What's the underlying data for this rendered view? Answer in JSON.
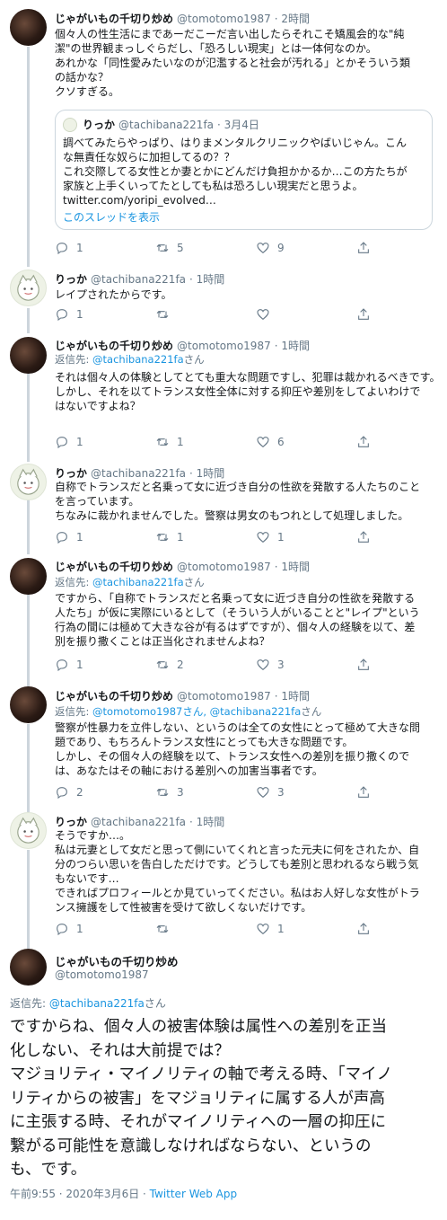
{
  "icons": {
    "reply": "reply-icon",
    "retweet": "retweet-icon",
    "like": "heart-icon",
    "share": "share-icon"
  },
  "colors": {
    "link": "#1b95e0",
    "meta": "#657786",
    "text": "#14171a",
    "thread": "#cdd5dc"
  },
  "tweets": [
    {
      "name": "じゃがいもの千切り炒め",
      "handle": "@tomotomo1987",
      "time": "· 2時間",
      "lines": [
        "個々人の性生活にまであーだこーだ言い出したらそれこそ矯風会的な\"純",
        "潔\"の世界観まっしぐらだし、「恐ろしい現実」とは一体何なのか。",
        "あれかな「同性愛みたいなのが氾濫すると社会が汚れる」とかそういう類",
        "の話かな？",
        "クソすぎる。"
      ],
      "quote": {
        "name": "りっか",
        "handle": "@tachibana221fa",
        "time": "· 3月4日",
        "lines": [
          "調べてみたらやっぱり、はりまメンタルクリニックやばいじゃん。こん",
          "な無責任な奴らに加担してるの？？",
          "これ交際してる女性とか妻とかにどんだけ負担かかるか…この方たちが",
          "家族と上手くいってたとしても私は恐ろしい現実だと思うよ。",
          "twitter.com/yoripi_evolved…"
        ],
        "show_thread": "このスレッドを表示"
      },
      "reply_count": "1",
      "retweet_count": "5",
      "like_count": "9"
    },
    {
      "name": "りっか",
      "handle": "@tachibana221fa",
      "time": "· 1時間",
      "lines": [
        "レイプされたからです。"
      ],
      "reply_count": "1",
      "retweet_count": "",
      "like_count": ""
    },
    {
      "name": "じゃがいもの千切り炒め",
      "handle": "@tomotomo1987",
      "time": "· 1時間",
      "reply_prefix": "返信先: ",
      "reply_target": "@tachibana221fa",
      "reply_suffix": "さん",
      "lines": [
        "それは個々人の体験としてとても重大な問題ですし、犯罪は裁かれるべきです。",
        "しかし、それを以てトランス女性全体に対する抑圧や差別をしてよいわけで",
        "はないですよね？"
      ],
      "reply_count": "1",
      "retweet_count": "1",
      "like_count": "6"
    },
    {
      "name": "りっか",
      "handle": "@tachibana221fa",
      "time": "· 1時間",
      "lines": [
        "自称でトランスだと名乗って女に近づき自分の性欲を発散する人たちのこと",
        "を言っています。",
        "ちなみに裁かれませんでした。警察は男女のもつれとして処理しました。"
      ],
      "reply_count": "1",
      "retweet_count": "1",
      "like_count": "1"
    },
    {
      "name": "じゃがいもの千切り炒め",
      "handle": "@tomotomo1987",
      "time": "· 1時間",
      "reply_prefix": "返信先: ",
      "reply_target": "@tachibana221fa",
      "reply_suffix": "さん",
      "lines": [
        "ですから、「自称でトランスだと名乗って女に近づき自分の性欲を発散する",
        "人たち」が仮に実際にいるとして（そういう人がいることと\"レイプ\"という",
        "行為の間には極めて大きな谷が有るはずですが）、個々人の経験を以て、差",
        "別を振り撒くことは正当化されませんよね？"
      ],
      "reply_count": "1",
      "retweet_count": "2",
      "like_count": "3"
    },
    {
      "name": "じゃがいもの千切り炒め",
      "handle": "@tomotomo1987",
      "time": "· 1時間",
      "reply_prefix": "返信先: ",
      "reply_target": "@tomotomo1987さん, @tachibana221fa",
      "reply_suffix": "さん",
      "lines": [
        "警察が性暴力を立件しない、というのは全ての女性にとって極めて大きな問",
        "題であり、もちろんトランス女性にとっても大きな問題です。",
        "しかし、その個々人の経験を以て、トランス女性への差別を振り撒くので",
        "は、あなたはその軸における差別への加害当事者です。"
      ],
      "reply_count": "2",
      "retweet_count": "3",
      "like_count": "3"
    },
    {
      "name": "りっか",
      "handle": "@tachibana221fa",
      "time": "· 1時間",
      "lines": [
        "そうですか…。",
        "私は元妻として女だと思って側にいてくれと言った元夫に何をされたか、自",
        "分のつらい思いを告白しただけです。どうしても差別と思われるなら戦う気",
        "もないです…",
        "できればプロフィールとか見ていってください。私はお人好しな女性がトラ",
        "ンス擁護をして性被害を受けて欲しくないだけです。"
      ],
      "reply_count": "1",
      "retweet_count": "",
      "like_count": "1"
    }
  ],
  "main": {
    "name": "じゃがいもの千切り炒め",
    "handle": "@tomotomo1987",
    "reply_prefix": "返信先: ",
    "reply_target": "@tachibana221fa",
    "reply_suffix": "さん",
    "lines": [
      "ですからね、個々人の被害体験は属性への差別を正当",
      "化しない、それは大前提では？",
      "マジョリティ・マイノリティの軸で考える時、「マイノ",
      "リティからの被害」をマジョリティに属する人が声高",
      "に主張する時、それがマイノリティへの一層の抑圧に",
      "繋がる可能性を意識しなければならない、というの",
      "も、です。"
    ],
    "timestamp": "午前9:55 · 2020年3月6日 · ",
    "app": "Twitter Web App"
  }
}
